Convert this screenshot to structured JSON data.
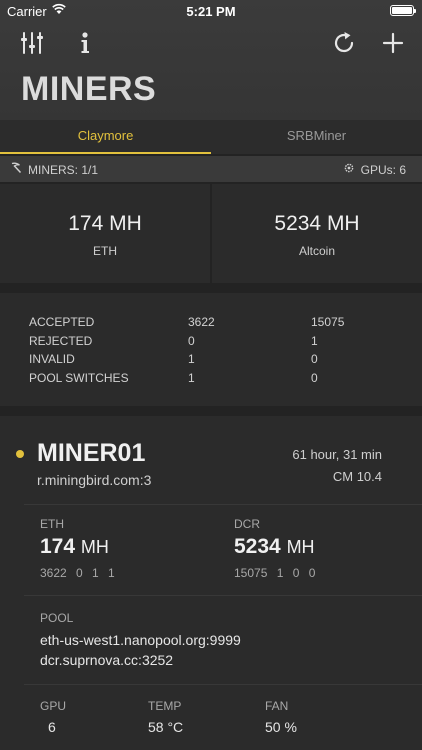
{
  "status_bar": {
    "carrier": "Carrier",
    "time": "5:21 PM"
  },
  "page": {
    "title": "MINERS"
  },
  "tabs": [
    {
      "label": "Claymore",
      "active": true
    },
    {
      "label": "SRBMiner",
      "active": false
    }
  ],
  "summary": {
    "miners": "MINERS: 1/1",
    "gpus": "GPUs: 6"
  },
  "hashrates": [
    {
      "value": "174 MH",
      "label": "ETH"
    },
    {
      "value": "5234 MH",
      "label": "Altcoin"
    }
  ],
  "stats": [
    {
      "label": "ACCEPTED",
      "eth": "3622",
      "alt": "15075"
    },
    {
      "label": "REJECTED",
      "eth": "0",
      "alt": "1"
    },
    {
      "label": "INVALID",
      "eth": "1",
      "alt": "0"
    },
    {
      "label": "POOL SWITCHES",
      "eth": "1",
      "alt": "0"
    }
  ],
  "miner": {
    "name": "MINER01",
    "host": "r.miningbird.com:3",
    "uptime": "61 hour, 31 min",
    "version": "CM 10.4",
    "coins": [
      {
        "label": "ETH",
        "value": "174",
        "unit": "MH",
        "shares": "3622 0 1 1"
      },
      {
        "label": "DCR",
        "value": "5234",
        "unit": "MH",
        "shares": "15075 1 0 0"
      }
    ],
    "pool_label": "POOL",
    "pools": [
      "eth-us-west1.nanopool.org:9999",
      "dcr.suprnova.cc:3252"
    ],
    "gpu": {
      "label": "GPU",
      "value": "6"
    },
    "temp": {
      "label": "TEMP",
      "value": "58 °C"
    },
    "fan": {
      "label": "FAN",
      "value": "50 %"
    }
  },
  "colors": {
    "accent": "#e2c13d",
    "background": "#232323",
    "header": "#3a3a3a",
    "card": "#2b2b2b"
  }
}
